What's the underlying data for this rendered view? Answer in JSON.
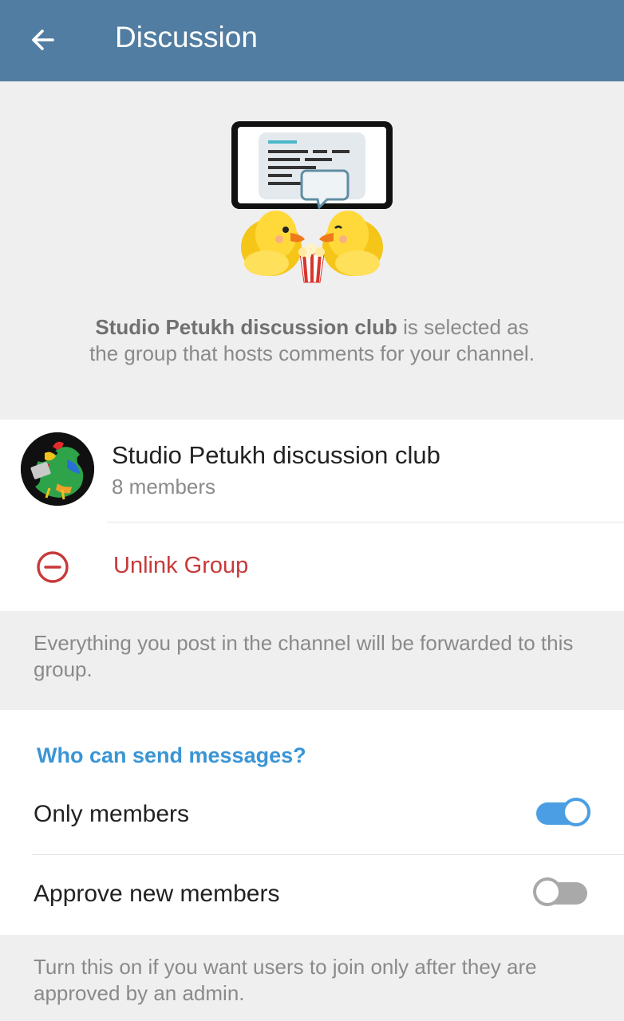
{
  "app_bar": {
    "title": "Discussion",
    "back_icon": "arrow-left-icon",
    "color": "#517da2"
  },
  "hero": {
    "group_name": "Studio Petukh discussion club",
    "text_suffix": " is selected as the group that hosts comments for your channel."
  },
  "linked_group": {
    "name": "Studio Petukh discussion club",
    "members": "8 members",
    "avatar_icon": "rooster-avatar-icon"
  },
  "unlink": {
    "label": "Unlink Group",
    "icon": "minus-circle-icon",
    "color": "#c8393a"
  },
  "forward_info": "Everything you post in the channel will be forwarded to this group.",
  "permissions": {
    "header": "Who can send messages?",
    "header_color": "#3a95d5",
    "toggles": [
      {
        "label": "Only members",
        "on": true
      },
      {
        "label": "Approve new members",
        "on": false
      }
    ]
  },
  "approve_info": "Turn this on if you want users to join only after they are approved by an admin."
}
